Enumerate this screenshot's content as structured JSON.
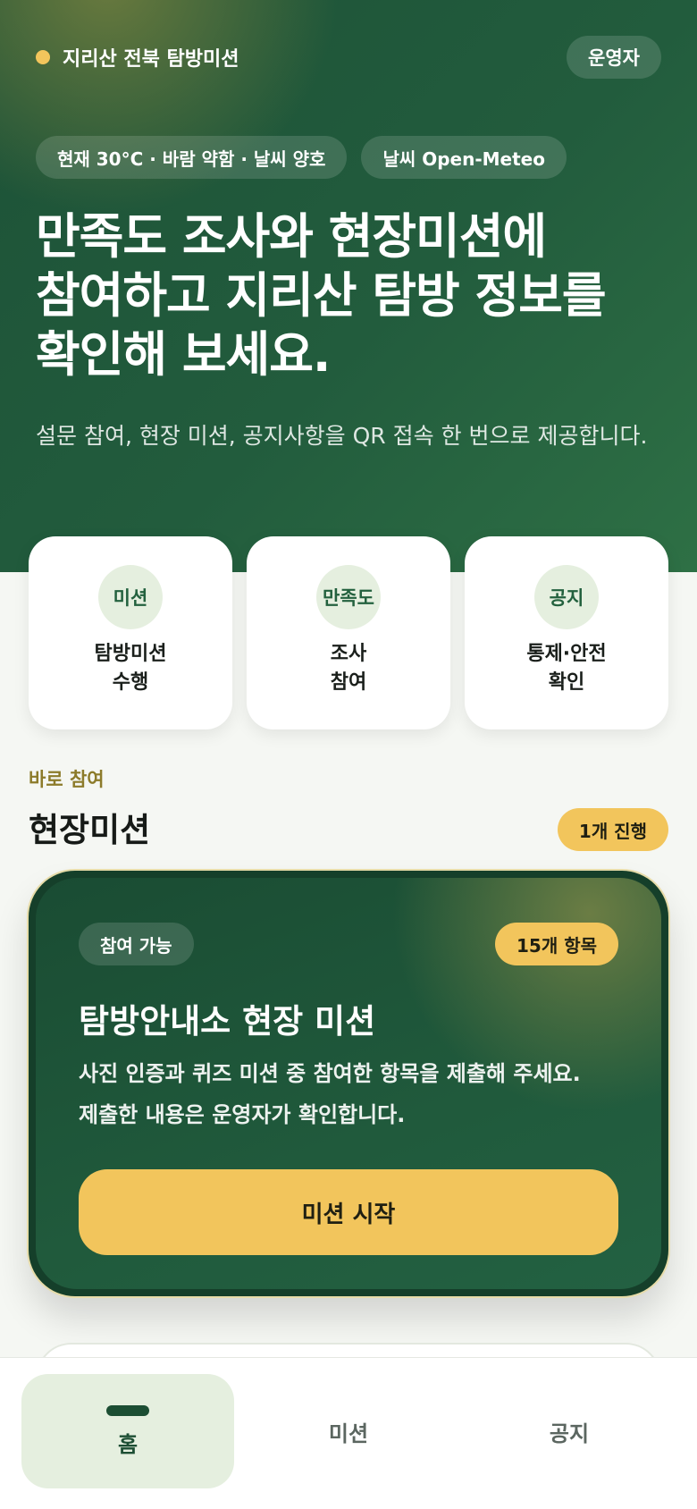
{
  "header": {
    "brand": "지리산 전북 탐방미션",
    "operator_label": "운영자"
  },
  "chips": {
    "weather": "현재 30°C · 바람 약함 · 날씨 양호",
    "source": "날씨 Open-Meteo"
  },
  "hero": {
    "title_line1": "만족도 조사와 현장미션에",
    "title_line2": "참여하고 지리산 탐방 정보를",
    "title_line3": "확인해 보세요.",
    "subtitle": "설문 참여, 현장 미션, 공지사항을 QR 접속 한 번으로 제공합니다."
  },
  "quick": [
    {
      "badge": "미션",
      "line1": "탐방미션",
      "line2": "수행"
    },
    {
      "badge": "만족도",
      "line1": "조사",
      "line2": "참여"
    },
    {
      "badge": "공지",
      "line1": "통제·안전",
      "line2": "확인"
    }
  ],
  "section": {
    "eyebrow": "바로 참여",
    "title": "현장미션",
    "count": "1개 진행"
  },
  "mission": {
    "status": "참여 가능",
    "items": "15개 항목",
    "title": "탐방안내소 현장 미션",
    "desc_line1": "사진 인증과 퀴즈 미션 중 참여한 항목을 제출해 주세요.",
    "desc_line2": "제출한 내용은 운영자가 확인합니다.",
    "button": "미션 시작"
  },
  "nav": [
    {
      "label": "홈",
      "active": true
    },
    {
      "label": "미션",
      "active": false
    },
    {
      "label": "공지",
      "active": false
    }
  ],
  "colors": {
    "brand_green": "#225c3d",
    "accent_yellow": "#f2c55c",
    "soft_green": "#e5efdf"
  }
}
